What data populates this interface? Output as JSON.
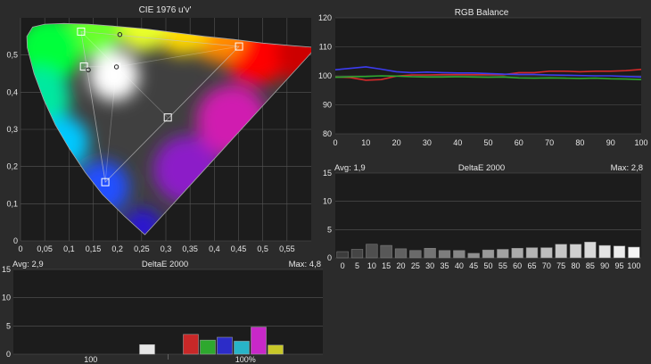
{
  "colors": {
    "background": "#2b2b2b",
    "plot_bg": "#1c1c1c",
    "grid": "#555555",
    "text": "#e6e6e6"
  },
  "chart_data": [
    {
      "id": "cie",
      "type": "scatter",
      "title": "CIE 1976 u'v'",
      "xlim": [
        0,
        0.6
      ],
      "ylim": [
        0,
        0.6
      ],
      "x_ticks": [
        "0",
        "0,05",
        "0,1",
        "0,15",
        "0,2",
        "0,25",
        "0,3",
        "0,35",
        "0,4",
        "0,45",
        "0,5",
        "0,55"
      ],
      "y_ticks": [
        "0",
        "0,1",
        "0,2",
        "0,3",
        "0,4",
        "0,5"
      ],
      "gamut_target": [
        [
          0.451,
          0.523
        ],
        [
          0.125,
          0.563
        ],
        [
          0.175,
          0.158
        ]
      ],
      "targets": [
        [
          0.451,
          0.523
        ],
        [
          0.125,
          0.563
        ],
        [
          0.175,
          0.158
        ],
        [
          0.131,
          0.469
        ],
        [
          0.198,
          0.468
        ],
        [
          0.304,
          0.332
        ]
      ],
      "measured": [
        [
          0.205,
          0.555
        ],
        [
          0.14,
          0.46
        ],
        [
          0.198,
          0.468
        ]
      ]
    },
    {
      "id": "rgb",
      "type": "line",
      "title": "RGB Balance",
      "xlim": [
        0,
        100
      ],
      "ylim": [
        80,
        120
      ],
      "x_ticks": [
        "0",
        "10",
        "20",
        "30",
        "40",
        "50",
        "60",
        "70",
        "80",
        "90",
        "100"
      ],
      "y_ticks": [
        "80",
        "90",
        "100",
        "110",
        "120"
      ],
      "x": [
        0,
        5,
        10,
        15,
        20,
        25,
        30,
        35,
        40,
        45,
        50,
        55,
        60,
        65,
        70,
        75,
        80,
        85,
        90,
        95,
        100
      ],
      "series": [
        {
          "color": "#d42a2a",
          "values": [
            99.6,
            99.4,
            98.5,
            98.7,
            99.9,
            100.3,
            100.3,
            100.4,
            100.4,
            100.4,
            100.4,
            100.4,
            101.1,
            101.1,
            101.6,
            101.6,
            101.4,
            101.6,
            101.6,
            101.8,
            102.2
          ]
        },
        {
          "color": "#2ea82e",
          "values": [
            99.5,
            99.7,
            99.8,
            100.0,
            99.9,
            99.7,
            99.6,
            99.6,
            99.7,
            99.6,
            99.5,
            99.6,
            99.3,
            99.2,
            99.3,
            99.2,
            99.1,
            99.2,
            99.0,
            98.9,
            98.7
          ]
        },
        {
          "color": "#3c3cf0",
          "values": [
            102.1,
            102.6,
            103.1,
            102.3,
            101.4,
            101.1,
            101.3,
            101.1,
            101.0,
            101.0,
            100.8,
            100.6,
            100.5,
            100.5,
            100.3,
            100.2,
            100.1,
            100.0,
            100.0,
            99.8,
            99.6
          ]
        }
      ]
    },
    {
      "id": "de_gray",
      "type": "bar",
      "title": "DeltaE 2000",
      "avg_label": "Avg: 1,9",
      "max_label": "Max: 2,8",
      "ylim": [
        0,
        15
      ],
      "y_ticks": [
        "0",
        "5",
        "10",
        "15"
      ],
      "categories": [
        "0",
        "5",
        "10",
        "15",
        "20",
        "25",
        "30",
        "35",
        "40",
        "45",
        "50",
        "55",
        "60",
        "65",
        "70",
        "75",
        "80",
        "85",
        "90",
        "95",
        "100"
      ],
      "values": [
        1.1,
        1.5,
        2.4,
        2.2,
        1.6,
        1.3,
        1.7,
        1.3,
        1.3,
        0.8,
        1.4,
        1.5,
        1.7,
        1.8,
        1.8,
        2.4,
        2.4,
        2.8,
        2.2,
        2.1,
        1.9
      ]
    },
    {
      "id": "de_color",
      "type": "bar",
      "title": "DeltaE 2000",
      "avg_label": "Avg: 2,9",
      "max_label": "Max: 4,8",
      "ylim": [
        0,
        15
      ],
      "y_ticks": [
        "0",
        "5",
        "10",
        "15"
      ],
      "groups": [
        "100",
        "100%"
      ],
      "bars": [
        {
          "color": "#e6e6e6",
          "value": 1.7
        },
        {
          "color": "#c82828",
          "value": 3.5
        },
        {
          "color": "#2ea82e",
          "value": 2.5
        },
        {
          "color": "#2c2cc8",
          "value": 3.0
        },
        {
          "color": "#28b4c8",
          "value": 2.3
        },
        {
          "color": "#c828c8",
          "value": 4.8
        },
        {
          "color": "#c8c828",
          "value": 1.6
        }
      ]
    }
  ]
}
